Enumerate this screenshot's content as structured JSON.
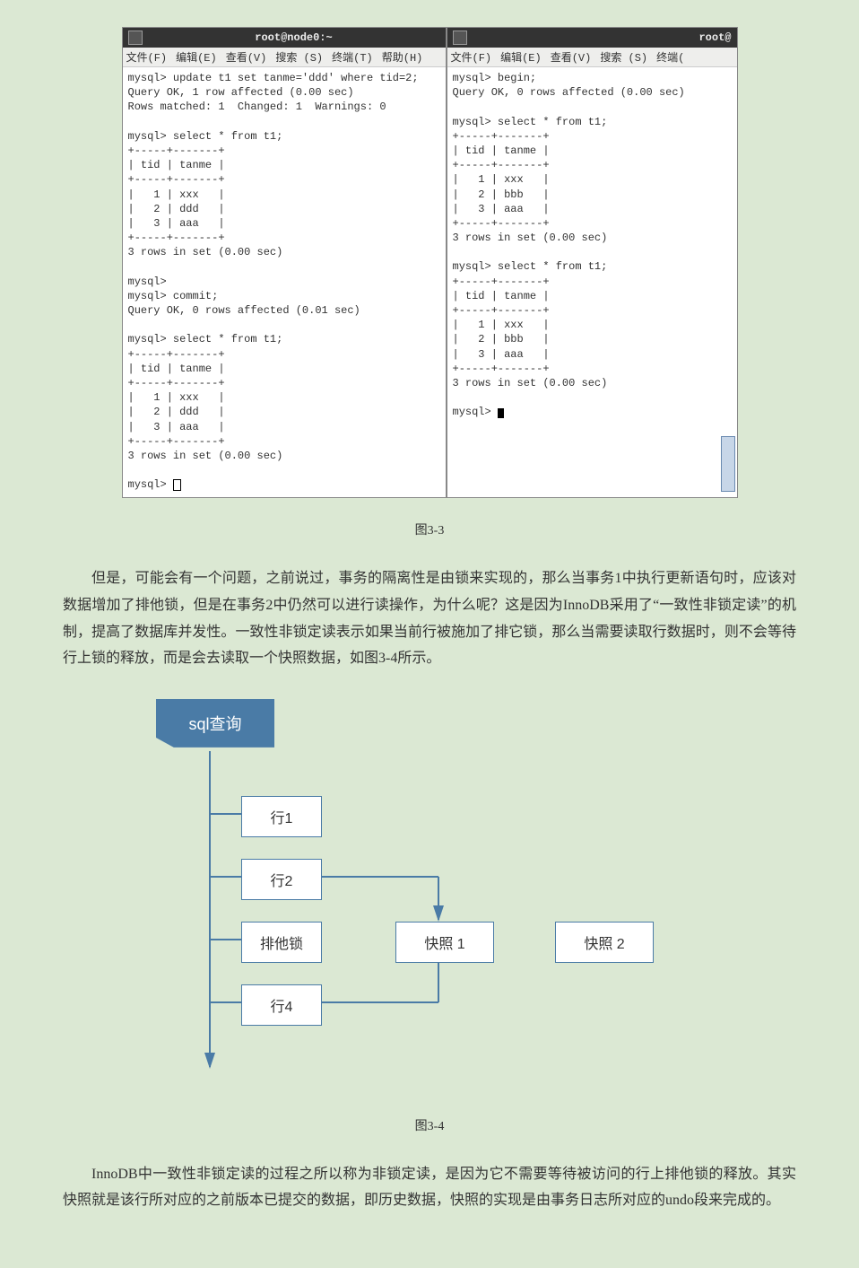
{
  "terminal_left": {
    "title": "root@node0:~",
    "menu": [
      "文件(F)",
      "编辑(E)",
      "查看(V)",
      "搜索 (S)",
      "终端(T)",
      "帮助(H)"
    ],
    "content": "mysql> update t1 set tanme='ddd' where tid=2;\nQuery OK, 1 row affected (0.00 sec)\nRows matched: 1  Changed: 1  Warnings: 0\n\nmysql> select * from t1;\n+-----+-------+\n| tid | tanme |\n+-----+-------+\n|   1 | xxx   |\n|   2 | ddd   |\n|   3 | aaa   |\n+-----+-------+\n3 rows in set (0.00 sec)\n\nmysql>\nmysql> commit;\nQuery OK, 0 rows affected (0.01 sec)\n\nmysql> select * from t1;\n+-----+-------+\n| tid | tanme |\n+-----+-------+\n|   1 | xxx   |\n|   2 | ddd   |\n|   3 | aaa   |\n+-----+-------+\n3 rows in set (0.00 sec)\n\nmysql> "
  },
  "terminal_right": {
    "title": "root@",
    "menu": [
      "文件(F)",
      "编辑(E)",
      "查看(V)",
      "搜索 (S)",
      "终端("
    ],
    "content": "mysql> begin;\nQuery OK, 0 rows affected (0.00 sec)\n\nmysql> select * from t1;\n+-----+-------+\n| tid | tanme |\n+-----+-------+\n|   1 | xxx   |\n|   2 | bbb   |\n|   3 | aaa   |\n+-----+-------+\n3 rows in set (0.00 sec)\n\nmysql> select * from t1;\n+-----+-------+\n| tid | tanme |\n+-----+-------+\n|   1 | xxx   |\n|   2 | bbb   |\n|   3 | aaa   |\n+-----+-------+\n3 rows in set (0.00 sec)\n\nmysql> "
  },
  "caption1": "图3-3",
  "para1": "但是，可能会有一个问题，之前说过，事务的隔离性是由锁来实现的，那么当事务1中执行更新语句时，应该对数据增加了排他锁，但是在事务2中仍然可以进行读操作，为什么呢？这是因为InnoDB采用了“一致性非锁定读”的机制，提高了数据库并发性。一致性非锁定读表示如果当前行被施加了排它锁，那么当需要读取行数据时，则不会等待行上锁的释放，而是会去读取一个快照数据，如图3-4所示。",
  "diagram": {
    "sql": "sql查询",
    "row1": "行1",
    "row2": "行2",
    "lock": "排他锁",
    "row4": "行4",
    "snap1": "快照 1",
    "snap2": "快照 2"
  },
  "caption2": "图3-4",
  "para2": "InnoDB中一致性非锁定读的过程之所以称为非锁定读，是因为它不需要等待被访问的行上排他锁的释放。其实快照就是该行所对应的之前版本已提交的数据，即历史数据，快照的实现是由事务日志所对应的undo段来完成的。"
}
